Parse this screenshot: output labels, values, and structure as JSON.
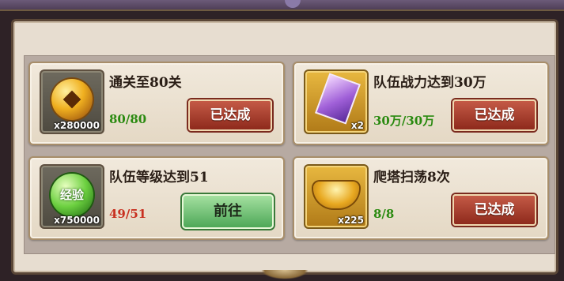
{
  "tasks": [
    {
      "title": "通关至80关",
      "progress": "80/80",
      "progress_color": "#2a8a10",
      "icon": "copper-coin-icon",
      "qty": "x280000",
      "button": "已达成",
      "status": "done"
    },
    {
      "title": "队伍战力达到30万",
      "progress": "30万/30万",
      "progress_color": "#2a8a10",
      "icon": "purple-gem-icon",
      "qty": "x2",
      "button": "已达成",
      "status": "done"
    },
    {
      "title": "队伍等级达到51",
      "progress": "49/51",
      "progress_color": "#c83020",
      "icon": "exp-orb-icon",
      "icon_text": "经验",
      "qty": "x750000",
      "button": "前往",
      "status": "go"
    },
    {
      "title": "爬塔扫荡8次",
      "progress": "8/8",
      "progress_color": "#2a8a10",
      "icon": "gold-ingot-icon",
      "qty": "x225",
      "button": "已达成",
      "status": "done"
    }
  ]
}
